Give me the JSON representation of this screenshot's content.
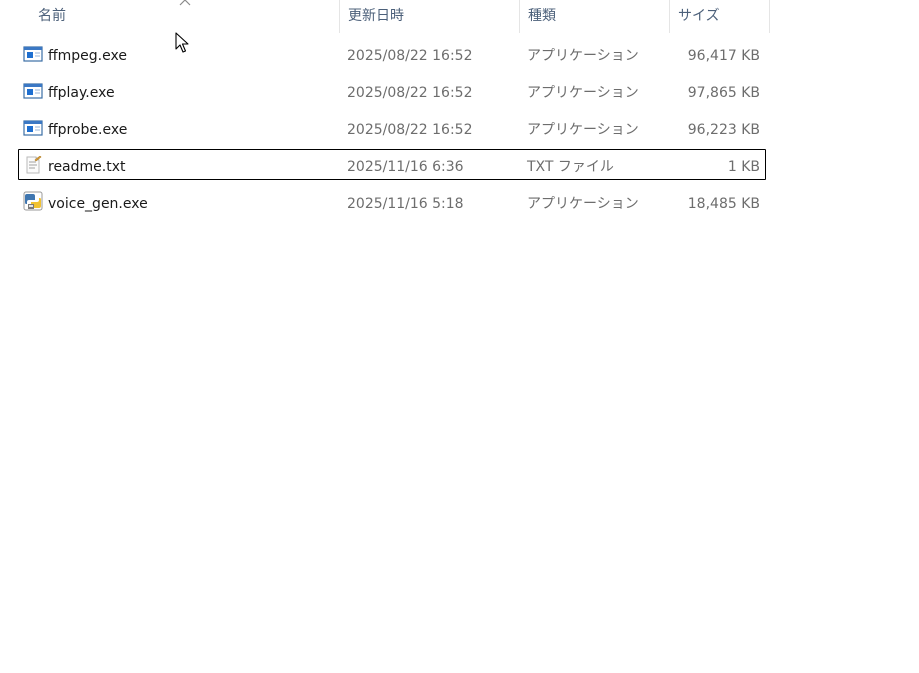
{
  "columns": {
    "name": "名前",
    "date": "更新日時",
    "type": "種類",
    "size": "サイズ"
  },
  "sort": {
    "column": "name",
    "direction": "ascending",
    "indicator": "sort-up-icon"
  },
  "files": [
    {
      "name": "ffmpeg.exe",
      "date": "2025/08/22 16:52",
      "type": "アプリケーション",
      "size": "96,417 KB",
      "icon": "application-icon"
    },
    {
      "name": "ffplay.exe",
      "date": "2025/08/22 16:52",
      "type": "アプリケーション",
      "size": "97,865 KB",
      "icon": "application-icon"
    },
    {
      "name": "ffprobe.exe",
      "date": "2025/08/22 16:52",
      "type": "アプリケーション",
      "size": "96,223 KB",
      "icon": "application-icon"
    },
    {
      "name": "readme.txt",
      "date": "2025/11/16 6:36",
      "type": "TXT ファイル",
      "size": "1 KB",
      "icon": "text-file-icon",
      "focused": true
    },
    {
      "name": "voice_gen.exe",
      "date": "2025/11/16 5:18",
      "type": "アプリケーション",
      "size": "18,485 KB",
      "icon": "python-app-icon"
    }
  ],
  "colors": {
    "header_text": "#4c607a",
    "detail_text": "#6d6d6d",
    "focus_border": "#000000"
  }
}
